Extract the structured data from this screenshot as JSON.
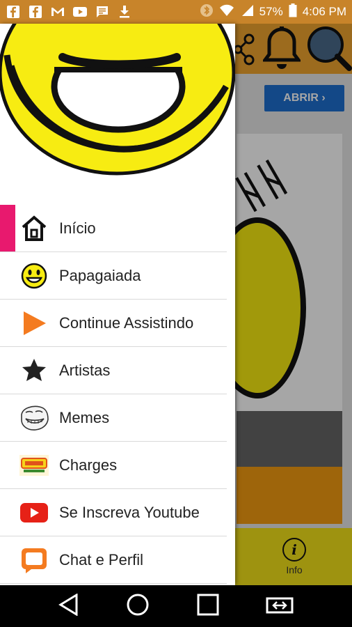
{
  "status_bar": {
    "battery": "57%",
    "time": "4:06 PM"
  },
  "app": {
    "open_button_label": "ABRIR ›",
    "info_label": "Info",
    "info_glyph": "i"
  },
  "drawer": {
    "items": [
      {
        "label": "Início",
        "icon": "home-icon",
        "active": true
      },
      {
        "label": "Papagaiada",
        "icon": "smiley-icon"
      },
      {
        "label": "Continue Assistindo",
        "icon": "play-icon"
      },
      {
        "label": "Artistas",
        "icon": "star-icon"
      },
      {
        "label": "Memes",
        "icon": "troll-face-icon"
      },
      {
        "label": "Charges",
        "icon": "charges-logo-icon"
      },
      {
        "label": "Se Inscreva Youtube",
        "icon": "youtube-icon"
      },
      {
        "label": "Chat e Perfil",
        "icon": "chat-icon"
      }
    ]
  },
  "colors": {
    "accent": "#e8196e",
    "header_yellow": "#f7ec12",
    "status_bar": "#c8842a",
    "youtube_red": "#e62117",
    "play_orange": "#f47b20"
  }
}
